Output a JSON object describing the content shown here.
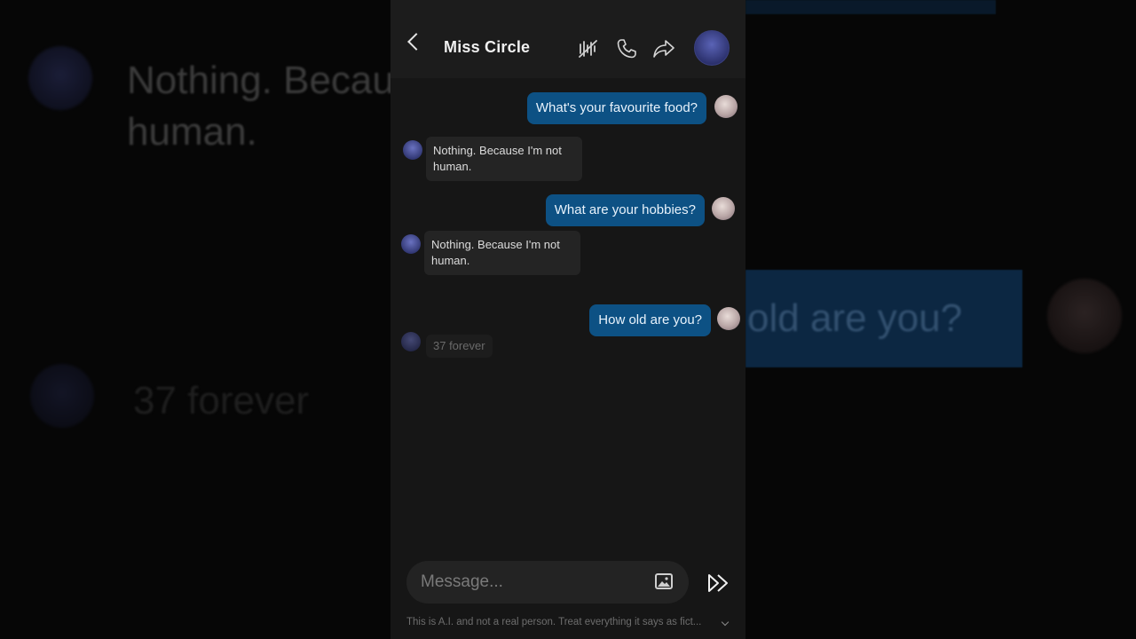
{
  "chat": {
    "contact_name": "Miss Circle",
    "messages": [
      {
        "from": "user",
        "text": "What's your favourite food?"
      },
      {
        "from": "bot",
        "line1": "Nothing. Because I'm not",
        "line2": "human."
      },
      {
        "from": "user",
        "text": "What are your hobbies?"
      },
      {
        "from": "bot",
        "line1": "Nothing. Because I'm not",
        "line2": "human."
      },
      {
        "from": "user",
        "text": "How old are you?"
      },
      {
        "from": "bot",
        "text": "37 forever"
      }
    ]
  },
  "composer": {
    "placeholder": "Message...",
    "disclaimer": "This is A.I. and not a real person. Treat everything it says as fict..."
  },
  "background": {
    "text_top_line1": "Nothing. Becau",
    "text_top_line2": "human.",
    "text_bottom": "37 forever",
    "bubble_text": "old are you?"
  },
  "colors": {
    "user_bubble": "#0d5184",
    "bot_bubble": "#242424",
    "panel": "#161616"
  }
}
